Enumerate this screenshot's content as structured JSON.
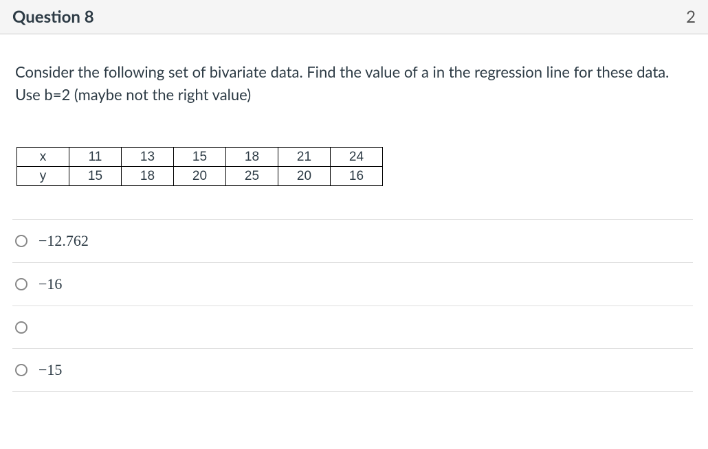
{
  "chart_data": {
    "type": "table",
    "rows": [
      {
        "label": "x",
        "values": [
          11,
          13,
          15,
          18,
          21,
          24
        ]
      },
      {
        "label": "y",
        "values": [
          15,
          18,
          20,
          25,
          20,
          16
        ]
      }
    ]
  },
  "header": {
    "title": "Question 8",
    "points": "2"
  },
  "prompt": "Consider the following set of bivariate data. Find the value of a in the regression line  for these data. Use b=2 (maybe not the right value)",
  "table": {
    "r0": {
      "c0": "x",
      "c1": "11",
      "c2": "13",
      "c3": "15",
      "c4": "18",
      "c5": "21",
      "c6": "24"
    },
    "r1": {
      "c0": "y",
      "c1": "15",
      "c2": "18",
      "c3": "20",
      "c4": "25",
      "c5": "20",
      "c6": "16"
    }
  },
  "options": {
    "a": "−12.762",
    "b": "−16",
    "c": "",
    "d": "−15"
  }
}
